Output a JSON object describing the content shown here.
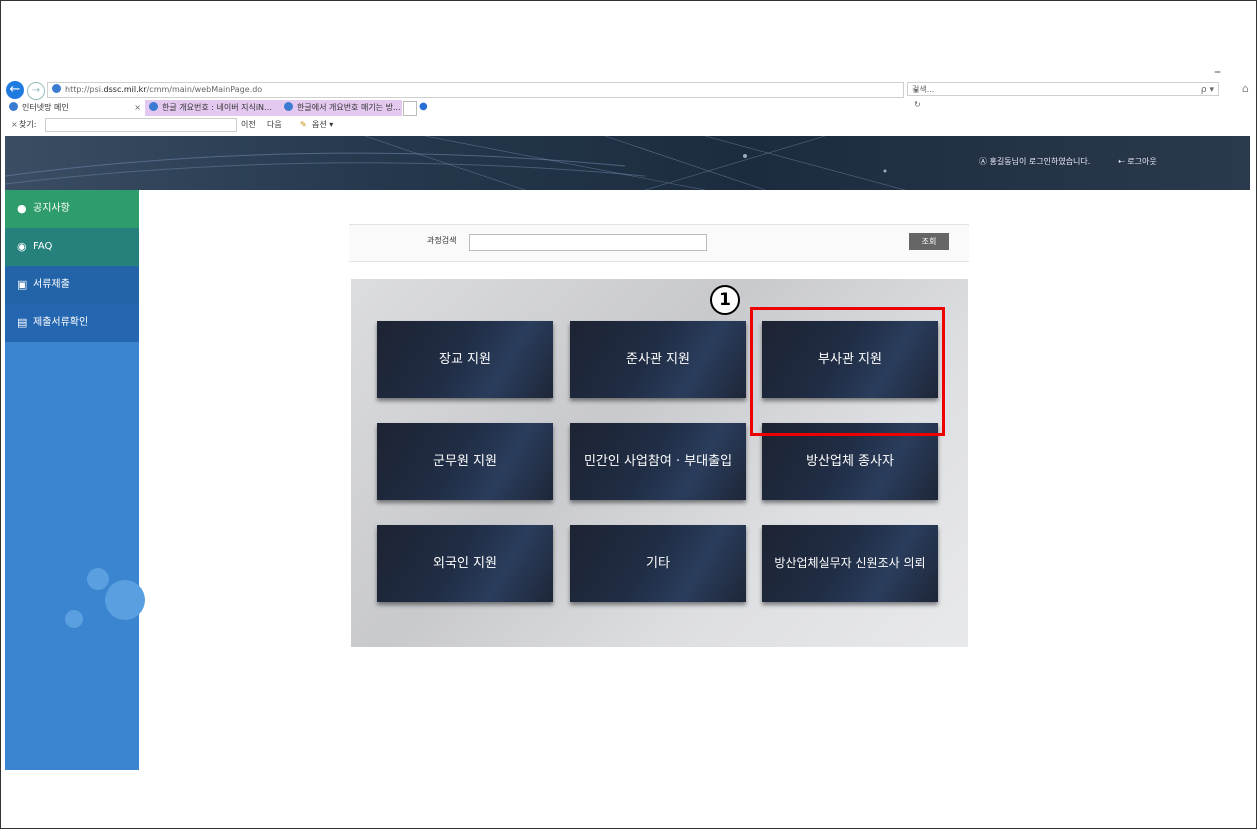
{
  "browser": {
    "url_prefix": "http://psi.",
    "url_host": "dssc.mil.kr",
    "url_path": "/cmm/main/webMainPage.do",
    "refresh": "▾ ↻",
    "search_placeholder": "검색...",
    "search_icon": "ρ ▾",
    "minimize": "–",
    "home": "⌂",
    "tabs": [
      {
        "label": "인터넷망 메인",
        "close": "×"
      },
      {
        "label": "한글 개요번호 : 네이버 지식iN..."
      },
      {
        "label": "한글에서 개요번호 매기는 방..."
      }
    ],
    "findbar": {
      "close": "×",
      "label": "찾기:",
      "prev": "이전",
      "next": "다음",
      "options": "옵션 ▾"
    }
  },
  "header": {
    "user_text": "홍길동님이 로그인하였습니다.",
    "logout": "로그아웃"
  },
  "sidebar": {
    "items": [
      {
        "label": "공지사항",
        "icon": "mic-icon",
        "glyph": "●"
      },
      {
        "label": "FAQ",
        "icon": "chat-icon",
        "glyph": "◉"
      },
      {
        "label": "서류제출",
        "icon": "upload-icon",
        "glyph": "▣"
      },
      {
        "label": "제출서류확인",
        "icon": "check-doc-icon",
        "glyph": "▤"
      }
    ]
  },
  "course_search": {
    "label": "과정검색",
    "button": "조회"
  },
  "tiles": [
    {
      "label": "장교 지원"
    },
    {
      "label": "준사관 지원"
    },
    {
      "label": "부사관 지원"
    },
    {
      "label": "군무원 지원"
    },
    {
      "label": "민간인 사업참여 · 부대출입"
    },
    {
      "label": "방산업체 종사자"
    },
    {
      "label": "외국인 지원"
    },
    {
      "label": "기타"
    },
    {
      "label": "방산업체실무자 신원조사 의뢰"
    }
  ],
  "annotation": {
    "marker": "1",
    "highlight_color": "#e00000"
  }
}
